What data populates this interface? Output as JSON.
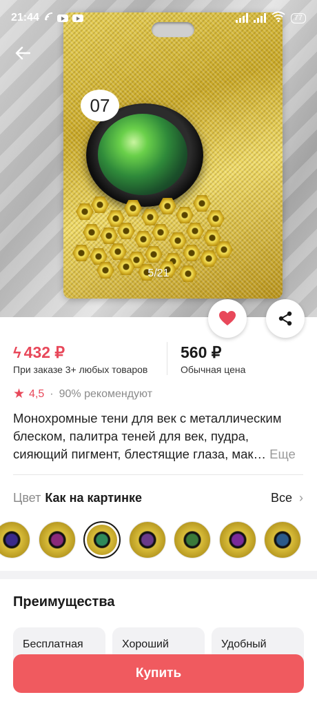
{
  "status_bar": {
    "time": "21:44",
    "battery": "77"
  },
  "gallery": {
    "image_number": "07",
    "counter": "5/21"
  },
  "price": {
    "sale_price": "432 ₽",
    "sale_note": "При заказе 3+ любых товаров",
    "regular_price": "560 ₽",
    "regular_note": "Обычная цена",
    "accent_color": "#e8485a"
  },
  "rating": {
    "score": "4,5",
    "separator": "·",
    "recommend": "90% рекомендуют"
  },
  "description": {
    "text": "Монохромные тени для век с металлическим блеском, палитра теней для век, пудра, сияющий пигмент, блестящие глаза, мак…",
    "more": "Еще"
  },
  "color_selector": {
    "label": "Цвет",
    "value": "Как на картинке",
    "all": "Все",
    "swatches": [
      {
        "color": "#3a2a8a"
      },
      {
        "color": "#8a2a7a"
      },
      {
        "color": "#2f8a5a"
      },
      {
        "color": "#6a3a8a"
      },
      {
        "color": "#3a7a3a"
      },
      {
        "color": "#7a2a9a"
      },
      {
        "color": "#2a5a8a"
      }
    ],
    "selected_index": 2
  },
  "advantages": {
    "title": "Преимущества",
    "cards": [
      "Бесплатная",
      "Хороший",
      "Удобный"
    ]
  },
  "buy_button": {
    "label": "Купить",
    "color": "#f05a5f"
  }
}
